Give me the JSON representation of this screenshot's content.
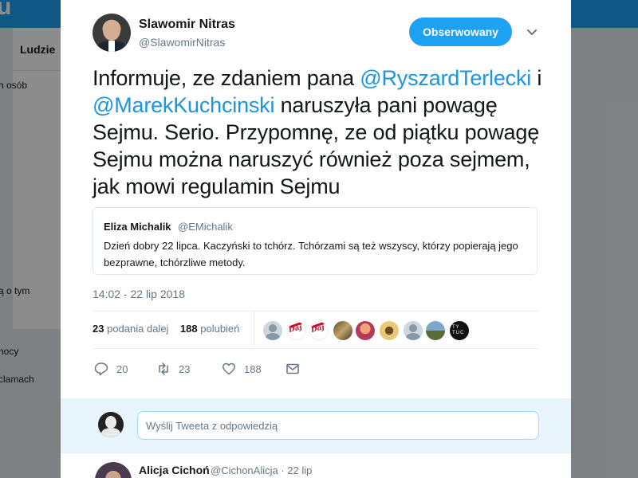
{
  "background": {
    "logo": "u",
    "tab_label": "Ludzie",
    "left_texts": [
      "h osób",
      "ą o tym",
      "nocy",
      "clamach"
    ]
  },
  "tweet": {
    "author_name": "Slawomir Nitras",
    "author_handle": "@SlawomirNitras",
    "follow_label": "Obserwowany",
    "text_parts": {
      "p1": "Informuje, ze zdaniem pana ",
      "m1": "@RyszardTerlecki",
      "p2": " i ",
      "m2": "@MarekKuchcinski",
      "p3": " naruszyła pani powagę Sejmu. Serio. Przypomnę, ze od piątku powagę Sejmu można naruszyć również poza sejmem, jak mowi regulamin Sejmu"
    },
    "quoted": {
      "name": "Eliza Michalik",
      "handle": "@EMichalik",
      "text": "Dzień dobry 22 lipca. Kaczyński to tchórz. Tchórzami są też wszyscy, którzy popierają jego bezprawne, tchórzliwe metody."
    },
    "timestamp": "14:02 - 22 lip 2018",
    "stats": {
      "retweets": "23",
      "retweets_label": "podania dalej",
      "likes": "188",
      "likes_label": "polubień"
    },
    "likers": [
      "default-avatar",
      "daj-logo",
      "daj-logo",
      "photo",
      "photo",
      "photo",
      "default-avatar",
      "photo",
      "photo"
    ],
    "actions": {
      "reply_count": "20",
      "retweet_count": "23",
      "like_count": "188"
    }
  },
  "reply": {
    "placeholder": "Wyślij Tweeta z odpowiedzią"
  },
  "next_tweet": {
    "author_name": "Alicja Cichoń",
    "author_handle": "@CichonAlicja",
    "date": "22 lip"
  },
  "colors": {
    "brand": "#1da1f2",
    "mention": "#1b95e0",
    "secondary_text": "#657786"
  }
}
